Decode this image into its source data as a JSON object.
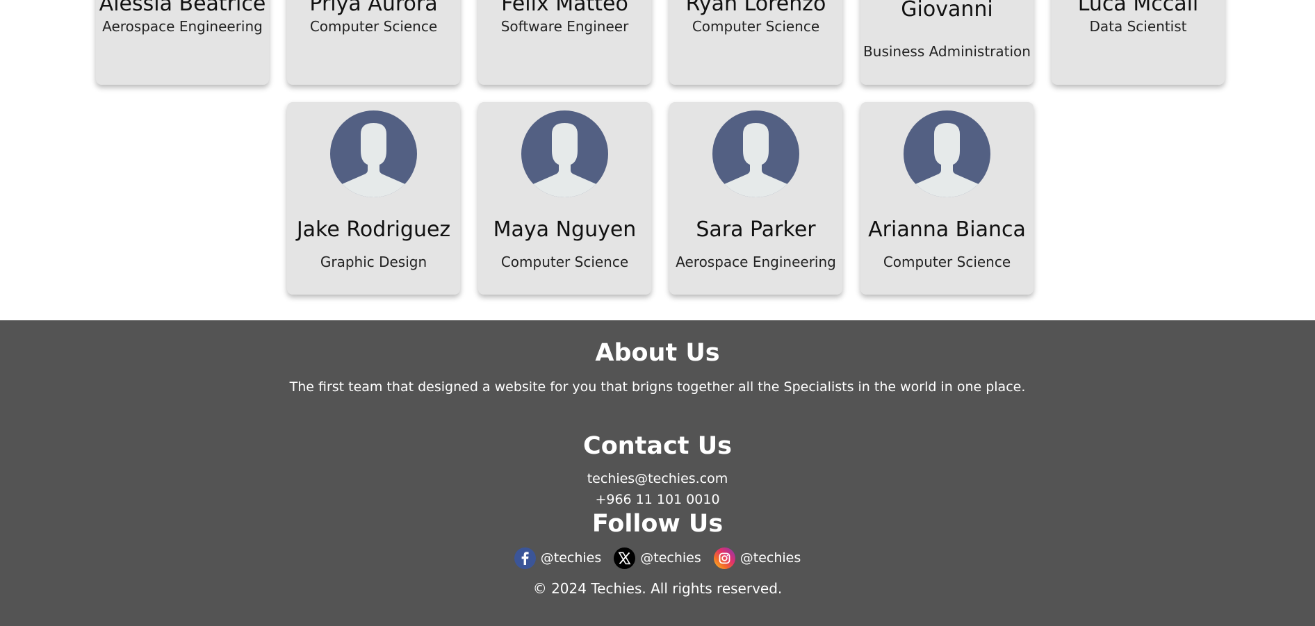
{
  "team_row_1": [
    {
      "name": "Alessia Beatrice",
      "major": "Aerospace Engineering"
    },
    {
      "name": "Priya Aurora",
      "major": "Computer Science"
    },
    {
      "name": "Felix Matteo",
      "major": "Software Engineer"
    },
    {
      "name": "Ryan Lorenzo",
      "major": "Computer Science"
    },
    {
      "name": "Isabella Giovanni",
      "major": "Business Administration"
    },
    {
      "name": "Luca Mccall",
      "major": "Data Scientist"
    }
  ],
  "team_row_2": [
    {
      "name": "Jake Rodriguez",
      "major": "Graphic Design",
      "icon": "person-avatar-icon"
    },
    {
      "name": "Maya Nguyen",
      "major": "Computer Science",
      "icon": "person-avatar-icon"
    },
    {
      "name": "Sara Parker",
      "major": "Aerospace Engineering",
      "icon": "person-avatar-icon"
    },
    {
      "name": "Arianna Bianca",
      "major": "Computer Science",
      "icon": "person-avatar-icon"
    }
  ],
  "footer": {
    "about_title": "About Us",
    "about_text": "The first team that designed a website for you that brigns together all the Specialists in the world in one place.",
    "contact_title": "Contact Us",
    "email": "techies@techies.com",
    "phone": "+966 11 101 0010",
    "follow_title": "Follow Us",
    "socials": [
      {
        "icon": "facebook-icon",
        "handle": "@techies",
        "color": "#3b5598"
      },
      {
        "icon": "x-icon",
        "handle": "@techies",
        "color": "#000000"
      },
      {
        "icon": "instagram-icon",
        "handle": "@techies",
        "color": "#e1306c"
      }
    ],
    "copyright": "© 2024 Techies. All rights reserved."
  },
  "colors": {
    "card_bg": "#e4e4e4",
    "avatar_bg": "#536083",
    "footer_bg": "#545454"
  }
}
